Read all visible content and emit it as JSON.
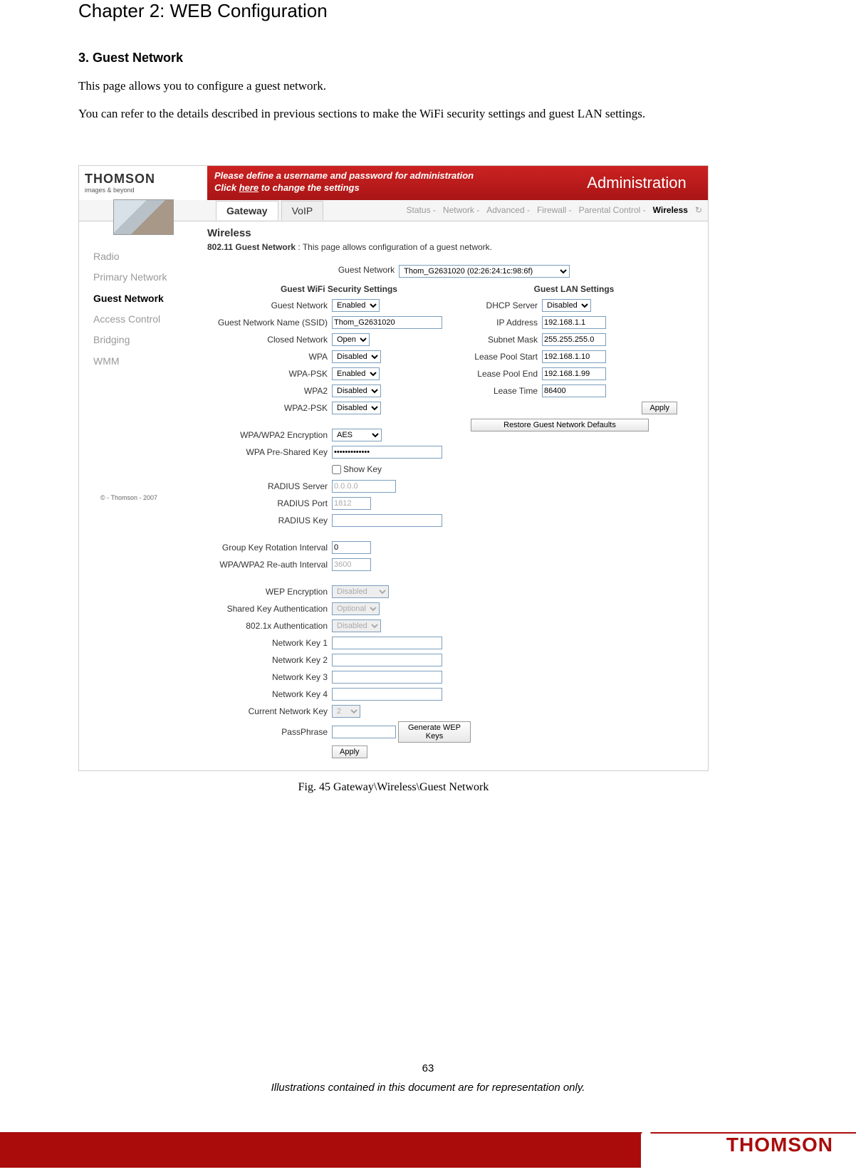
{
  "chapter": "Chapter 2: WEB Configuration",
  "section": "3. Guest Network",
  "para1": "This page allows you to configure a guest network.",
  "para2": "You can refer to the details described in previous sections to make the WiFi security settings and guest LAN settings.",
  "caption": "Fig. 45 Gateway\\Wireless\\Guest Network",
  "page_num": "63",
  "disclaimer": "Illustrations contained in this document are for representation only.",
  "brand": "THOMSON",
  "ss": {
    "logo_main": "THOMSON",
    "logo_sub": "images & beyond",
    "banner_l1": "Please define a username and password for administration",
    "banner_l2a": "Click ",
    "banner_l2b": "here",
    "banner_l2c": " to change the settings",
    "banner_right": "Administration",
    "tabs": {
      "gateway": "Gateway",
      "voip": "VoIP"
    },
    "menu": {
      "status": "Status -",
      "network": "Network -",
      "advanced": "Advanced -",
      "firewall": "Firewall -",
      "parental": "Parental Control -",
      "wireless": "Wireless"
    },
    "sidebar": {
      "radio": "Radio",
      "primary": "Primary Network",
      "guest": "Guest Network",
      "access": "Access Control",
      "bridging": "Bridging",
      "wmm": "WMM"
    },
    "copyright": "© - Thomson - 2007",
    "h1": "Wireless",
    "desc_b": "802.11 Guest Network",
    "desc_r": " :  This page allows configuration of a guest network.",
    "top_label": "Guest Network",
    "top_value": "Thom_G2631020 (02:26:24:1c:98:6f)",
    "sec_wifi": "Guest WiFi Security Settings",
    "sec_lan": "Guest LAN Settings",
    "l": {
      "gn": "Guest Network",
      "gn_v": "Enabled",
      "ssid": "Guest Network Name (SSID)",
      "ssid_v": "Thom_G2631020",
      "closed": "Closed Network",
      "closed_v": "Open",
      "wpa": "WPA",
      "wpa_v": "Disabled",
      "wpapsk": "WPA-PSK",
      "wpapsk_v": "Enabled",
      "wpa2": "WPA2",
      "wpa2_v": "Disabled",
      "wpa2psk": "WPA2-PSK",
      "wpa2psk_v": "Disabled",
      "enc": "WPA/WPA2 Encryption",
      "enc_v": "AES",
      "psk": "WPA Pre-Shared Key",
      "psk_v": "•••••••••••••",
      "showkey": "Show Key",
      "rserver": "RADIUS Server",
      "rserver_v": "0.0.0.0",
      "rport": "RADIUS Port",
      "rport_v": "1812",
      "rkey": "RADIUS Key",
      "rkey_v": "",
      "gkri": "Group Key Rotation Interval",
      "gkri_v": "0",
      "reauth": "WPA/WPA2 Re-auth Interval",
      "reauth_v": "3600",
      "wep": "WEP Encryption",
      "wep_v": "Disabled",
      "ska": "Shared Key Authentication",
      "ska_v": "Optional",
      "dot1x": "802.1x Authentication",
      "dot1x_v": "Disabled",
      "nk1": "Network Key 1",
      "nk1_v": "",
      "nk2": "Network Key 2",
      "nk2_v": "",
      "nk3": "Network Key 3",
      "nk3_v": "",
      "nk4": "Network Key 4",
      "nk4_v": "",
      "cnk": "Current Network Key",
      "cnk_v": "2",
      "pass": "PassPhrase",
      "pass_v": "",
      "genwep": "Generate WEP Keys",
      "apply": "Apply"
    },
    "r": {
      "dhcp": "DHCP Server",
      "dhcp_v": "Disabled",
      "ip": "IP Address",
      "ip_v": "192.168.1.1",
      "mask": "Subnet Mask",
      "mask_v": "255.255.255.0",
      "lps": "Lease Pool Start",
      "lps_v": "192.168.1.10",
      "lpe": "Lease Pool End",
      "lpe_v": "192.168.1.99",
      "lt": "Lease Time",
      "lt_v": "86400",
      "apply": "Apply",
      "restore": "Restore Guest Network Defaults"
    }
  }
}
